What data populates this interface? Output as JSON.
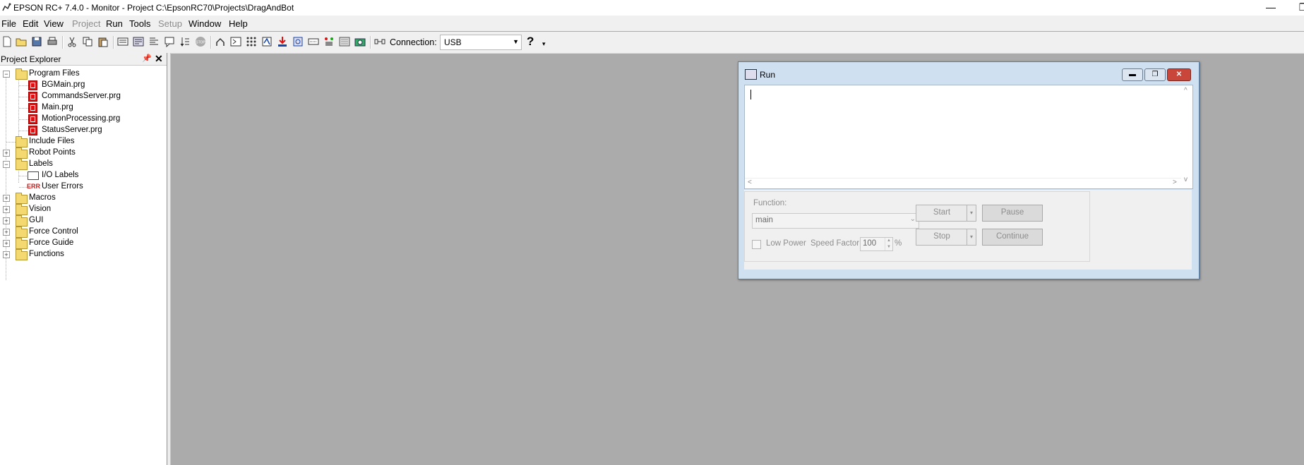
{
  "window": {
    "title": "EPSON RC+ 7.4.0 - Monitor - Project C:\\EpsonRC70\\Projects\\DragAndBot",
    "minimize_glyph": "—",
    "restore_glyph": "❐"
  },
  "menu": [
    "File",
    "Edit",
    "View",
    "Project",
    "Run",
    "Tools",
    "Setup",
    "Window",
    "Help"
  ],
  "toolbar": {
    "connection_label": "Connection:",
    "connection_value": "USB",
    "help_glyph": "?"
  },
  "explorer": {
    "title": "Project Explorer",
    "tree": [
      {
        "label": "Program Files",
        "type": "folder",
        "expanded": true
      },
      {
        "label": "BGMain.prg",
        "type": "prg"
      },
      {
        "label": "CommandsServer.prg",
        "type": "prg"
      },
      {
        "label": "Main.prg",
        "type": "prg"
      },
      {
        "label": "MotionProcessing.prg",
        "type": "prg"
      },
      {
        "label": "StatusServer.prg",
        "type": "prg"
      },
      {
        "label": "Include Files",
        "type": "folder"
      },
      {
        "label": "Robot Points",
        "type": "folder"
      },
      {
        "label": "Labels",
        "type": "folder",
        "expanded": true
      },
      {
        "label": "I/O Labels",
        "type": "io"
      },
      {
        "label": "User Errors",
        "type": "err"
      },
      {
        "label": "Macros",
        "type": "folder"
      },
      {
        "label": "Vision",
        "type": "folder"
      },
      {
        "label": "GUI",
        "type": "folder"
      },
      {
        "label": "Force Control",
        "type": "folder"
      },
      {
        "label": "Force Guide",
        "type": "folder"
      },
      {
        "label": "Functions",
        "type": "folder"
      }
    ],
    "err_icon_text": "ERR"
  },
  "run_window": {
    "title": "Run",
    "function_label": "Function:",
    "function_value": "main",
    "low_power_label": "Low Power",
    "speed_factor_label": "Speed Factor:",
    "speed_factor_value": "100",
    "percent": "%",
    "start_label": "Start",
    "stop_label": "Stop",
    "pause_label": "Pause",
    "continue_label": "Continue"
  }
}
